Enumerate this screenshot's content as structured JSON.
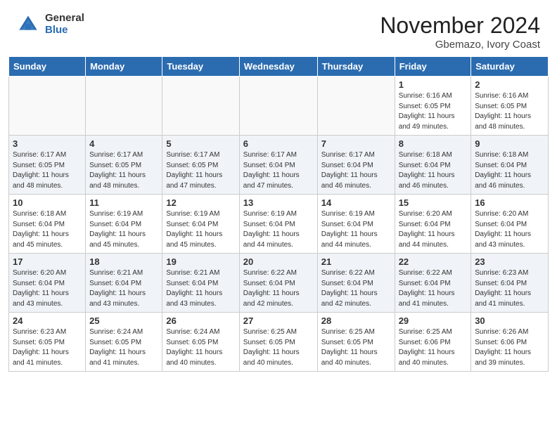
{
  "header": {
    "logo_general": "General",
    "logo_blue": "Blue",
    "month_title": "November 2024",
    "subtitle": "Gbemazo, Ivory Coast"
  },
  "weekdays": [
    "Sunday",
    "Monday",
    "Tuesday",
    "Wednesday",
    "Thursday",
    "Friday",
    "Saturday"
  ],
  "weeks": [
    [
      {
        "day": "",
        "info": ""
      },
      {
        "day": "",
        "info": ""
      },
      {
        "day": "",
        "info": ""
      },
      {
        "day": "",
        "info": ""
      },
      {
        "day": "",
        "info": ""
      },
      {
        "day": "1",
        "info": "Sunrise: 6:16 AM\nSunset: 6:05 PM\nDaylight: 11 hours\nand 49 minutes."
      },
      {
        "day": "2",
        "info": "Sunrise: 6:16 AM\nSunset: 6:05 PM\nDaylight: 11 hours\nand 48 minutes."
      }
    ],
    [
      {
        "day": "3",
        "info": "Sunrise: 6:17 AM\nSunset: 6:05 PM\nDaylight: 11 hours\nand 48 minutes."
      },
      {
        "day": "4",
        "info": "Sunrise: 6:17 AM\nSunset: 6:05 PM\nDaylight: 11 hours\nand 48 minutes."
      },
      {
        "day": "5",
        "info": "Sunrise: 6:17 AM\nSunset: 6:05 PM\nDaylight: 11 hours\nand 47 minutes."
      },
      {
        "day": "6",
        "info": "Sunrise: 6:17 AM\nSunset: 6:04 PM\nDaylight: 11 hours\nand 47 minutes."
      },
      {
        "day": "7",
        "info": "Sunrise: 6:17 AM\nSunset: 6:04 PM\nDaylight: 11 hours\nand 46 minutes."
      },
      {
        "day": "8",
        "info": "Sunrise: 6:18 AM\nSunset: 6:04 PM\nDaylight: 11 hours\nand 46 minutes."
      },
      {
        "day": "9",
        "info": "Sunrise: 6:18 AM\nSunset: 6:04 PM\nDaylight: 11 hours\nand 46 minutes."
      }
    ],
    [
      {
        "day": "10",
        "info": "Sunrise: 6:18 AM\nSunset: 6:04 PM\nDaylight: 11 hours\nand 45 minutes."
      },
      {
        "day": "11",
        "info": "Sunrise: 6:19 AM\nSunset: 6:04 PM\nDaylight: 11 hours\nand 45 minutes."
      },
      {
        "day": "12",
        "info": "Sunrise: 6:19 AM\nSunset: 6:04 PM\nDaylight: 11 hours\nand 45 minutes."
      },
      {
        "day": "13",
        "info": "Sunrise: 6:19 AM\nSunset: 6:04 PM\nDaylight: 11 hours\nand 44 minutes."
      },
      {
        "day": "14",
        "info": "Sunrise: 6:19 AM\nSunset: 6:04 PM\nDaylight: 11 hours\nand 44 minutes."
      },
      {
        "day": "15",
        "info": "Sunrise: 6:20 AM\nSunset: 6:04 PM\nDaylight: 11 hours\nand 44 minutes."
      },
      {
        "day": "16",
        "info": "Sunrise: 6:20 AM\nSunset: 6:04 PM\nDaylight: 11 hours\nand 43 minutes."
      }
    ],
    [
      {
        "day": "17",
        "info": "Sunrise: 6:20 AM\nSunset: 6:04 PM\nDaylight: 11 hours\nand 43 minutes."
      },
      {
        "day": "18",
        "info": "Sunrise: 6:21 AM\nSunset: 6:04 PM\nDaylight: 11 hours\nand 43 minutes."
      },
      {
        "day": "19",
        "info": "Sunrise: 6:21 AM\nSunset: 6:04 PM\nDaylight: 11 hours\nand 43 minutes."
      },
      {
        "day": "20",
        "info": "Sunrise: 6:22 AM\nSunset: 6:04 PM\nDaylight: 11 hours\nand 42 minutes."
      },
      {
        "day": "21",
        "info": "Sunrise: 6:22 AM\nSunset: 6:04 PM\nDaylight: 11 hours\nand 42 minutes."
      },
      {
        "day": "22",
        "info": "Sunrise: 6:22 AM\nSunset: 6:04 PM\nDaylight: 11 hours\nand 41 minutes."
      },
      {
        "day": "23",
        "info": "Sunrise: 6:23 AM\nSunset: 6:04 PM\nDaylight: 11 hours\nand 41 minutes."
      }
    ],
    [
      {
        "day": "24",
        "info": "Sunrise: 6:23 AM\nSunset: 6:05 PM\nDaylight: 11 hours\nand 41 minutes."
      },
      {
        "day": "25",
        "info": "Sunrise: 6:24 AM\nSunset: 6:05 PM\nDaylight: 11 hours\nand 41 minutes."
      },
      {
        "day": "26",
        "info": "Sunrise: 6:24 AM\nSunset: 6:05 PM\nDaylight: 11 hours\nand 40 minutes."
      },
      {
        "day": "27",
        "info": "Sunrise: 6:25 AM\nSunset: 6:05 PM\nDaylight: 11 hours\nand 40 minutes."
      },
      {
        "day": "28",
        "info": "Sunrise: 6:25 AM\nSunset: 6:05 PM\nDaylight: 11 hours\nand 40 minutes."
      },
      {
        "day": "29",
        "info": "Sunrise: 6:25 AM\nSunset: 6:06 PM\nDaylight: 11 hours\nand 40 minutes."
      },
      {
        "day": "30",
        "info": "Sunrise: 6:26 AM\nSunset: 6:06 PM\nDaylight: 11 hours\nand 39 minutes."
      }
    ]
  ]
}
